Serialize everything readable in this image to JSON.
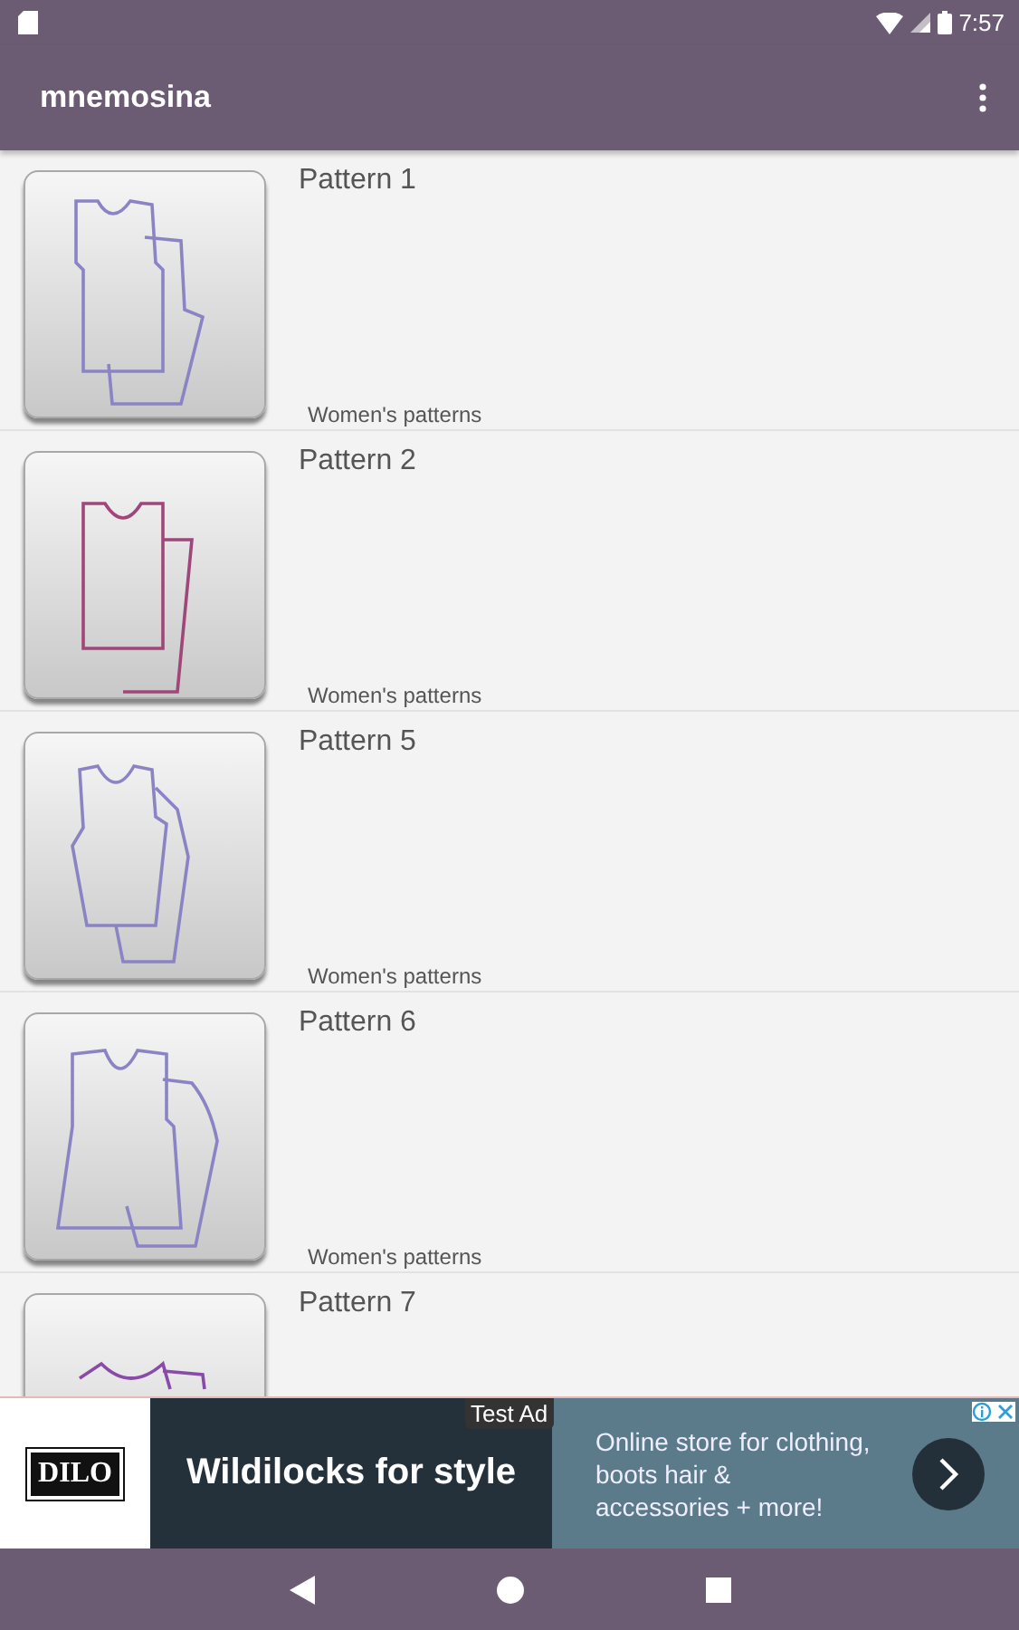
{
  "status_bar": {
    "time": "7:57"
  },
  "app_bar": {
    "title": "mnemosina"
  },
  "patterns": [
    {
      "title": "Pattern 1",
      "category": "Women's patterns",
      "color": "#8a84c4"
    },
    {
      "title": "Pattern 2",
      "category": "Women's patterns",
      "color": "#a0467a"
    },
    {
      "title": "Pattern 5",
      "category": "Women's patterns",
      "color": "#8a84c4"
    },
    {
      "title": "Pattern 6",
      "category": "Women's patterns",
      "color": "#8a84c4"
    },
    {
      "title": "Pattern 7",
      "color": "#8a4aa8"
    }
  ],
  "ad": {
    "label": "Test Ad",
    "logo": "DILO",
    "headline": "Wildilocks for style",
    "body": "Online store for clothing, boots hair & accessories + more!"
  }
}
